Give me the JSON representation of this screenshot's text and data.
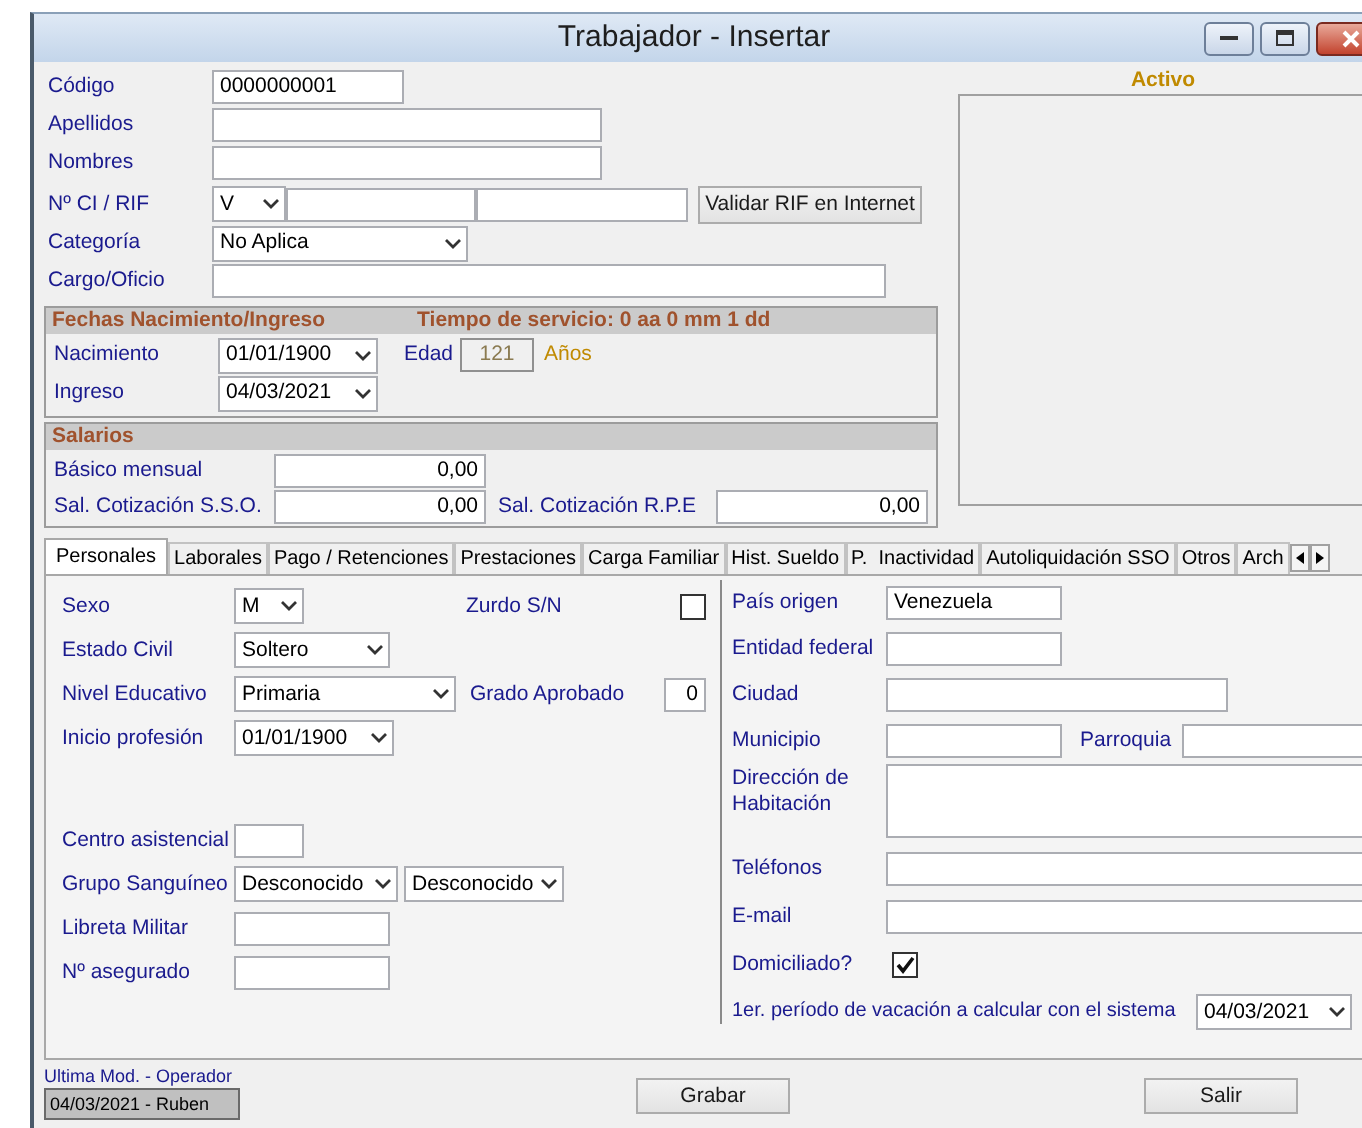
{
  "window": {
    "title": "Trabajador - Insertar"
  },
  "identity": [
    {
      "kind": "text",
      "label": "Código",
      "value": "0000000001"
    },
    {
      "kind": "text",
      "label": "Apellidos"
    },
    {
      "kind": "text",
      "label": "Nombres"
    },
    {
      "kind": "rif",
      "label": "Nº CI / RIF",
      "value": "V",
      "button": "Validar RIF en Internet"
    },
    {
      "kind": "select",
      "label": "Categoría",
      "value": "No Aplica"
    },
    {
      "kind": "text",
      "label": "Cargo/Oficio"
    }
  ],
  "status_label": "Activo",
  "dates_group": {
    "title": "Fechas Nacimiento/Ingreso",
    "service_time": "Tiempo de servicio: 0 aa 0 mm 1 dd",
    "birth": {
      "label": "Nacimiento",
      "value": "01/01/1900"
    },
    "age": {
      "label": "Edad",
      "value": "121",
      "unit": "Años"
    },
    "hire": {
      "label": "Ingreso",
      "value": "04/03/2021"
    }
  },
  "salary_group": {
    "title": "Salarios",
    "basic": {
      "label": "Básico mensual",
      "value": "0,00"
    },
    "sso": {
      "label": "Sal. Cotización S.S.O.",
      "value": "0,00"
    },
    "rpe": {
      "label": "Sal. Cotización R.P.E",
      "value": "0,00"
    }
  },
  "tabs": [
    {
      "label": "Personales",
      "selected": true
    },
    {
      "label": "Laborales",
      "selected": false
    },
    {
      "label": "Pago / Retenciones",
      "selected": false
    },
    {
      "label": "Prestaciones",
      "selected": false
    },
    {
      "label": "Carga Familiar",
      "selected": false
    },
    {
      "label": "Hist. Sueldo",
      "selected": false
    },
    {
      "label": "P.  Inactividad",
      "selected": false
    },
    {
      "label": "Autoliquidación SSO",
      "selected": false
    },
    {
      "label": "Otros",
      "selected": false
    },
    {
      "label": "Arch",
      "selected": false
    }
  ],
  "personal": {
    "sexo": {
      "label": "Sexo",
      "value": "M"
    },
    "zurdo": {
      "label": "Zurdo S/N",
      "checked": false
    },
    "estado_civil": {
      "label": "Estado Civil",
      "value": "Soltero"
    },
    "nivel_educativo": {
      "label": "Nivel Educativo",
      "value": "Primaria"
    },
    "grado_aprobado": {
      "label": "Grado Aprobado",
      "value": "0"
    },
    "inicio_profesion": {
      "label": "Inicio profesión",
      "value": "01/01/1900"
    },
    "centro_asistencial": {
      "label": "Centro asistencial"
    },
    "grupo_sanguineo": {
      "label": "Grupo Sanguíneo",
      "values": [
        "Desconocido",
        "Desconocido"
      ]
    },
    "libreta_militar": {
      "label": "Libreta Militar"
    },
    "numero_asegurado": {
      "label": "Nº asegurado"
    }
  },
  "address": {
    "pais": {
      "label": "País origen",
      "value": "Venezuela"
    },
    "entidad": {
      "label": "Entidad federal"
    },
    "ciudad": {
      "label": "Ciudad"
    },
    "municipio": {
      "label": "Municipio"
    },
    "parroquia": {
      "label": "Parroquia"
    },
    "direccion": {
      "label": "Dirección de Habitación"
    },
    "telefonos": {
      "label": "Teléfonos"
    },
    "email": {
      "label": "E-mail"
    },
    "domiciliado": {
      "label": "Domiciliado?",
      "checked": true
    },
    "vacacion": {
      "label": "1er. período de vacación a calcular con el sistema",
      "value": "04/03/2021"
    }
  },
  "footer": {
    "last_mod_label": "Ultima Mod. - Operador",
    "last_mod_value": "04/03/2021 - Ruben",
    "buttons": [
      "Grabar",
      "Salir"
    ]
  }
}
